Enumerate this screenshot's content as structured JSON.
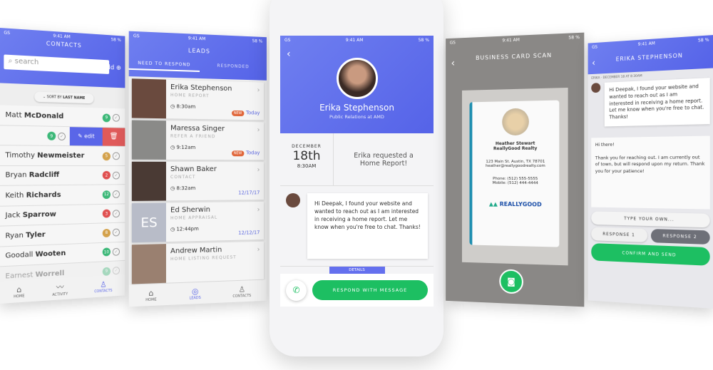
{
  "status": {
    "carrier": "GS",
    "time": "9:41 AM",
    "battery": "58 %"
  },
  "contacts": {
    "title": "CONTACTS",
    "add": "Add",
    "search_placeholder": "search",
    "sort_prefix": "SORT BY",
    "sort_field": "LAST NAME",
    "edit": "edit",
    "swiped_count": "9",
    "swiped_color": "#3cb878",
    "rows": [
      {
        "first": "Matt",
        "last": "McDonald",
        "count": "9",
        "color": "#3cb878"
      },
      {
        "first": "Timothy",
        "last": "Newmeister",
        "count": "5",
        "color": "#d4a24c"
      },
      {
        "first": "Bryan",
        "last": "Radcliff",
        "count": "2",
        "color": "#e05050"
      },
      {
        "first": "Keith",
        "last": "Richards",
        "count": "12",
        "color": "#3cb878"
      },
      {
        "first": "Jack",
        "last": "Sparrow",
        "count": "3",
        "color": "#e05050"
      },
      {
        "first": "Ryan",
        "last": "Tyler",
        "count": "8",
        "color": "#d4a24c"
      },
      {
        "first": "Goodall",
        "last": "Wooten",
        "count": "10",
        "color": "#3cb878"
      },
      {
        "first": "Earnest",
        "last": "Worrell",
        "count": "9",
        "color": "#3cb878"
      }
    ],
    "nav": [
      "HOME",
      "ACTIVITY",
      "CONTACTS"
    ]
  },
  "leads": {
    "title": "LEADS",
    "tabs": [
      "NEED TO RESPOND",
      "RESPONDED"
    ],
    "items": [
      {
        "name": "Erika Stephenson",
        "type": "HOME REPORT",
        "time": "8:30am",
        "new": "NEW",
        "date": "Today"
      },
      {
        "name": "Maressa Singer",
        "type": "REFER A FRIEND",
        "time": "9:12am",
        "new": "NEW",
        "date": "Today"
      },
      {
        "name": "Shawn Baker",
        "type": "CONTACT",
        "time": "8:32am",
        "new": "",
        "date": "12/17/17"
      },
      {
        "name": "Ed Sherwin",
        "type": "HOME APPRAISAL",
        "time": "12:44pm",
        "new": "",
        "date": "12/12/17",
        "initials": "ES"
      },
      {
        "name": "Andrew Martin",
        "type": "HOME LISTING REQUEST",
        "time": "",
        "new": "",
        "date": ""
      }
    ],
    "nav": [
      "HOME",
      "LEADS",
      "CONTACTS"
    ]
  },
  "detail": {
    "name": "Erika Stephenson",
    "subtitle": "Public Relations at AMD",
    "month": "DECEMBER",
    "day": "18th",
    "time": "8:30AM",
    "request": "Erika requested a Home Report!",
    "message": "Hi Deepak, I found your website and wanted to reach out as I am interested in receiving a home report. Let me know when you're free to chat.  Thanks!",
    "details_tab": "DETAILS",
    "respond": "RESPOND WITH MESSAGE"
  },
  "scan": {
    "title": "BUSINESS CARD SCAN",
    "card": {
      "name": "Heather Stewart",
      "company": "ReallyGood Realty",
      "address": "123 Main St. Austin, TX 78701",
      "email": "heather@reallygoodrealty.com",
      "phone": "Phone: (512) 555-5555",
      "mobile": "Mobile: (512) 444-4444",
      "logo": "REALLYGOOD",
      "logo_sub": "REALTY"
    }
  },
  "chat": {
    "title": "ERIKA STEPHENSON",
    "meta": "ERIKA · DECEMBER 18 AT 8:30AM",
    "message": "Hi Deepak, I found your website and wanted to reach out as I am interested in receiving a home report. Let me know when you're free to chat.  Thanks!",
    "reply_greeting": "Hi there!",
    "reply_body": "Thank you for reaching out. I am currently out of town, but will respond upon my return.  Thank you for your patience!",
    "type_own": "TYPE YOUR OWN...",
    "response1": "RESPONSE 1",
    "response2": "RESPONSE 2",
    "confirm": "CONFIRM AND SEND"
  },
  "colors": {
    "accent": "#5a66e8",
    "green": "#1dbf62"
  }
}
